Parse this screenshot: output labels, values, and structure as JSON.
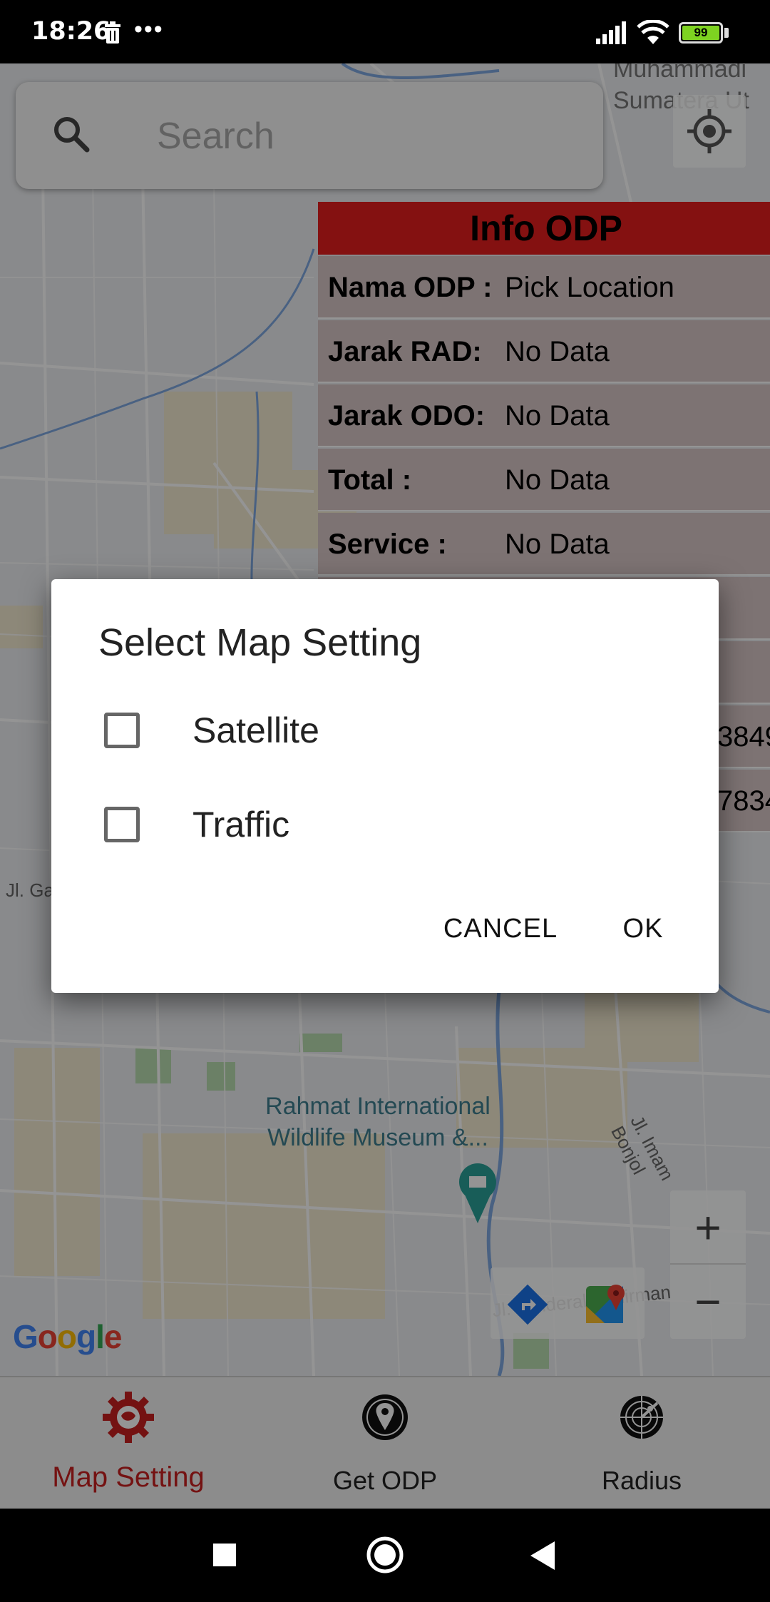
{
  "status_bar": {
    "time": "18:26",
    "overflow": "•••",
    "battery": "99",
    "icons": [
      "trash-icon",
      "signal-icon",
      "wifi-icon",
      "battery-icon"
    ]
  },
  "map": {
    "search_placeholder": "Search",
    "poi_label_line1": "Rahmat International",
    "poi_label_line2": "Wildlife Museum &...",
    "corner_label_line1": "Muhammadi",
    "corner_label_line2": "Sumatera Ut",
    "road_imam_bonjol": "Jl. Imam Bonjol",
    "road_sudirman": "Jl. Jenderal Sudirman",
    "road_left": "Jl. Ga",
    "google_logo": "Google",
    "zoom_in": "+",
    "zoom_out": "−"
  },
  "info_odp": {
    "title": "Info ODP",
    "rows": [
      {
        "key": "Nama ODP  :",
        "value": "Pick Location"
      },
      {
        "key": "Jarak RAD:",
        "value": "No Data"
      },
      {
        "key": "Jarak ODO:",
        "value": "No Data"
      },
      {
        "key": "Total :",
        "value": "No Data"
      },
      {
        "key": "Service   :",
        "value": "No Data"
      }
    ],
    "partial_values": [
      "3849",
      "7834"
    ]
  },
  "dialog": {
    "title": "Select Map Setting",
    "options": [
      {
        "label": "Satellite",
        "checked": false
      },
      {
        "label": "Traffic",
        "checked": false
      }
    ],
    "cancel_label": "CANCEL",
    "ok_label": "OK"
  },
  "bottom_nav": {
    "items": [
      {
        "label": "Map Setting",
        "icon": "gear-icon",
        "active": true
      },
      {
        "label": "Get ODP",
        "icon": "location-pin-icon",
        "active": false
      },
      {
        "label": "Radius",
        "icon": "radar-icon",
        "active": false
      }
    ]
  },
  "colors": {
    "accent_red": "#c92020",
    "info_header": "#e31e1e",
    "info_row": "#d8c6c6"
  }
}
